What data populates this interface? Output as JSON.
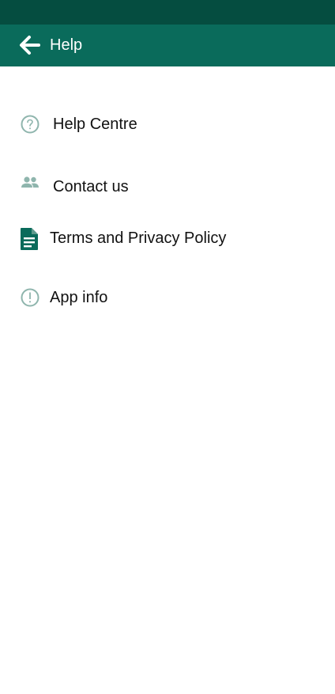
{
  "header": {
    "title": "Help",
    "back_icon": "arrow-left-icon"
  },
  "menu": {
    "items": [
      {
        "label": "Help Centre",
        "icon": "question-circle-icon"
      },
      {
        "label": "Contact us",
        "icon": "people-icon"
      },
      {
        "label": "Terms and Privacy Policy",
        "icon": "document-icon"
      },
      {
        "label": "App info",
        "icon": "info-circle-icon"
      }
    ]
  },
  "colors": {
    "status_bar": "#054d40",
    "app_bar": "#0a6b5b",
    "icon_muted": "#8fb5ad",
    "icon_dark": "#0a6b5b"
  }
}
